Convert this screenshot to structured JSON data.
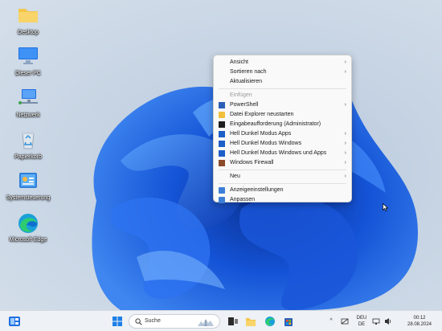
{
  "desktop": {
    "icons": [
      {
        "label": "Desktop",
        "icon": "folder-icon"
      },
      {
        "label": "Dieser PC",
        "icon": "monitor-icon"
      },
      {
        "label": "Netzwerk",
        "icon": "network-icon"
      },
      {
        "label": "Papierkorb",
        "icon": "recycle-bin-icon"
      },
      {
        "label": "Systemsteuerung",
        "icon": "control-panel-icon"
      },
      {
        "label": "Microsoft Edge",
        "icon": "edge-icon"
      }
    ]
  },
  "context_menu": {
    "view": "Ansicht",
    "sort_by": "Sortieren nach",
    "refresh": "Aktualisieren",
    "paste": "Einfügen",
    "powershell": "PowerShell",
    "restart_explorer": "Datei Explorer neustarten",
    "cmd_admin": "Eingabeaufforderung (Administrator)",
    "light_dark_apps": "Hell Dunkel Modus Apps",
    "light_dark_windows": "Hell Dunkel Modus Windows",
    "light_dark_windows_apps": "Hell Dunkel Modus Windows und Apps",
    "firewall": "Windows Firewall",
    "new": "Neu",
    "display_settings": "Anzeigeeinstellungen",
    "personalize": "Anpassen",
    "submenu_glyph": "›"
  },
  "taskbar": {
    "search_placeholder": "Suche",
    "tray_chevron": "^",
    "language_line1": "DEU",
    "language_line2": "DE",
    "time": "00:12",
    "date": "28.08.2024"
  },
  "colors": {
    "accent": "#1d5fc7",
    "taskbar_bg": "#eef1f5",
    "menu_bg": "#f9f9f9"
  }
}
